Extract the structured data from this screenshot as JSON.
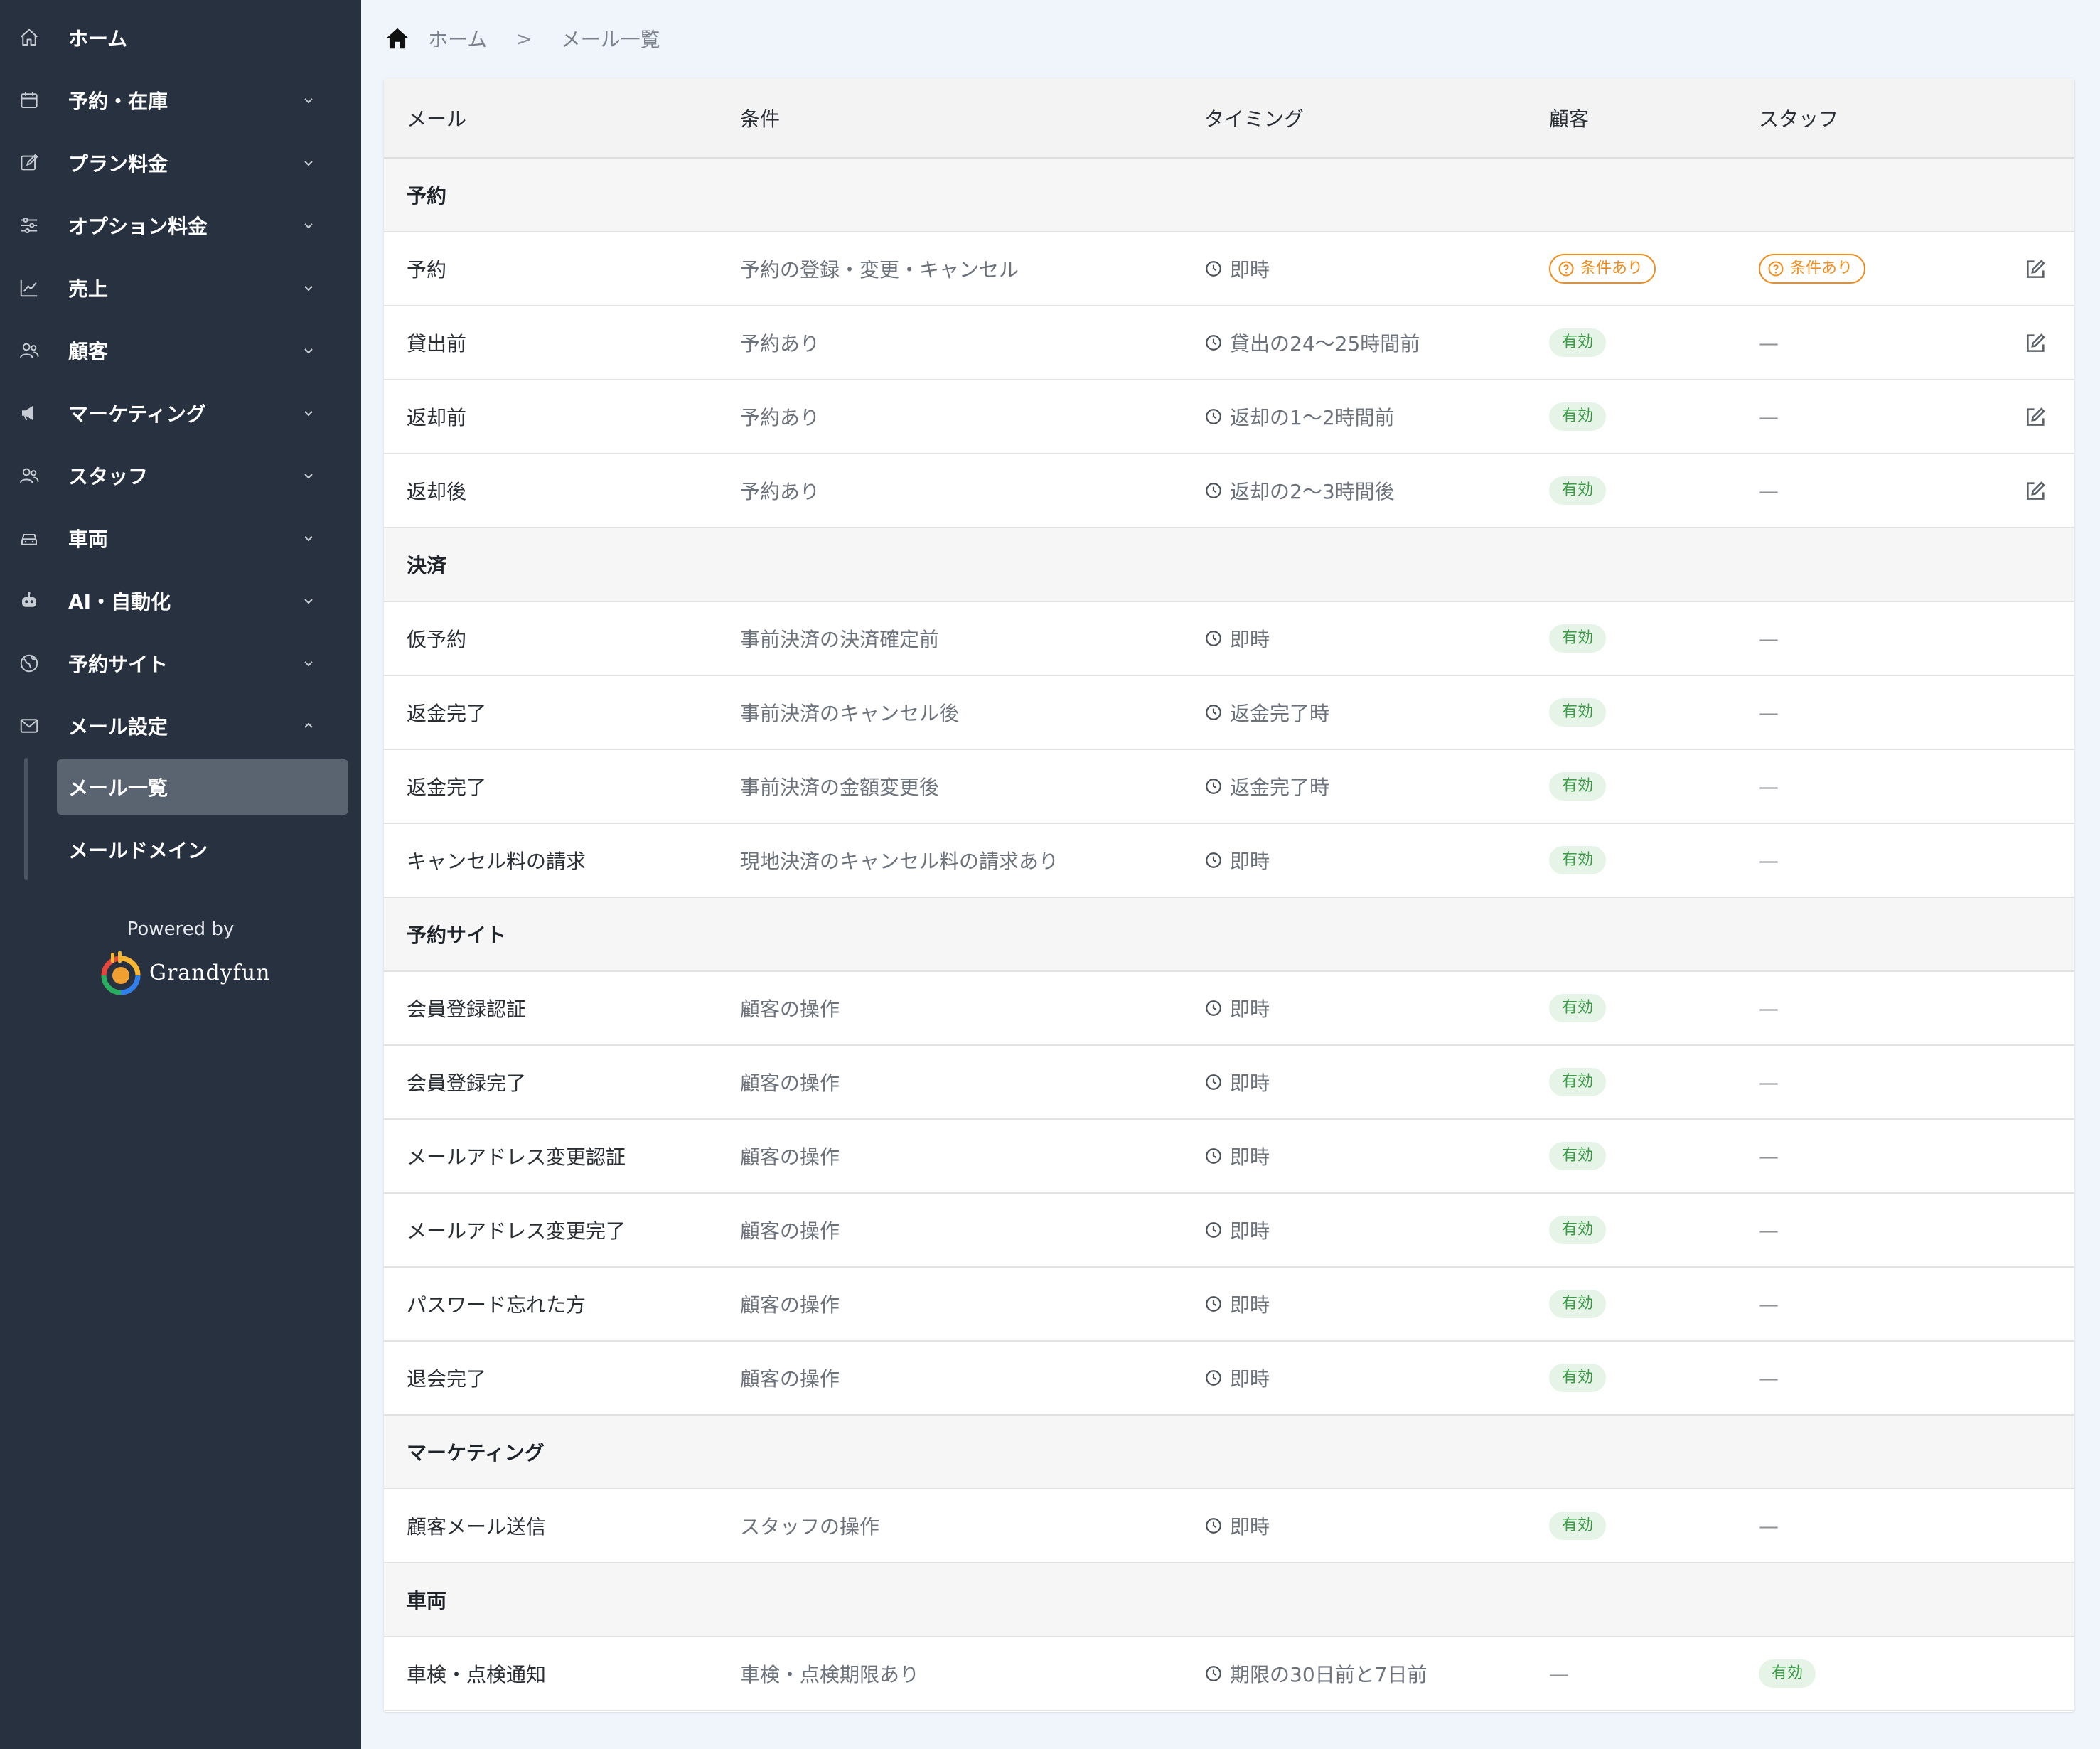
{
  "sidebar": {
    "items": [
      {
        "label": "ホーム",
        "icon": "home-icon",
        "has_chevron": false
      },
      {
        "label": "予約・在庫",
        "icon": "calendar-icon",
        "has_chevron": true
      },
      {
        "label": "プラン料金",
        "icon": "edit-square-icon",
        "has_chevron": true
      },
      {
        "label": "オプション料金",
        "icon": "sliders-icon",
        "has_chevron": true
      },
      {
        "label": "売上",
        "icon": "line-chart-icon",
        "has_chevron": true
      },
      {
        "label": "顧客",
        "icon": "users-icon",
        "has_chevron": true
      },
      {
        "label": "マーケティング",
        "icon": "megaphone-icon",
        "has_chevron": true
      },
      {
        "label": "スタッフ",
        "icon": "staff-icon",
        "has_chevron": true
      },
      {
        "label": "車両",
        "icon": "car-icon",
        "has_chevron": true
      },
      {
        "label": "AI・自動化",
        "icon": "robot-icon",
        "has_chevron": true
      },
      {
        "label": "予約サイト",
        "icon": "globe-icon",
        "has_chevron": true
      },
      {
        "label": "メール設定",
        "icon": "mail-icon",
        "has_chevron": true,
        "expanded": true
      }
    ],
    "sub_items": [
      {
        "label": "メール一覧",
        "active": true
      },
      {
        "label": "メールドメイン",
        "active": false
      }
    ],
    "powered_by": "Powered by",
    "brand": "Grandyfun"
  },
  "breadcrumb": {
    "home": "ホーム",
    "separator": ">",
    "current": "メール一覧"
  },
  "table": {
    "headers": [
      "メール",
      "条件",
      "タイミング",
      "顧客",
      "スタッフ"
    ],
    "rows": [
      {
        "type": "section",
        "title": "予約"
      },
      {
        "type": "row",
        "mail": "予約",
        "condition": "予約の登録・変更・キャンセル",
        "timing": "即時",
        "customer": "条件あり",
        "customer_kind": "cond",
        "staff": "条件あり",
        "staff_kind": "cond",
        "editable": true
      },
      {
        "type": "row",
        "mail": "貸出前",
        "condition": "予約あり",
        "timing": "貸出の24〜25時間前",
        "customer": "有効",
        "customer_kind": "ok",
        "staff": "—",
        "staff_kind": "none",
        "editable": true
      },
      {
        "type": "row",
        "mail": "返却前",
        "condition": "予約あり",
        "timing": "返却の1〜2時間前",
        "customer": "有効",
        "customer_kind": "ok",
        "staff": "—",
        "staff_kind": "none",
        "editable": true
      },
      {
        "type": "row",
        "mail": "返却後",
        "condition": "予約あり",
        "timing": "返却の2〜3時間後",
        "customer": "有効",
        "customer_kind": "ok",
        "staff": "—",
        "staff_kind": "none",
        "editable": true
      },
      {
        "type": "section",
        "title": "決済"
      },
      {
        "type": "row",
        "mail": "仮予約",
        "condition": "事前決済の決済確定前",
        "timing": "即時",
        "customer": "有効",
        "customer_kind": "ok",
        "staff": "—",
        "staff_kind": "none",
        "editable": false
      },
      {
        "type": "row",
        "mail": "返金完了",
        "condition": "事前決済のキャンセル後",
        "timing": "返金完了時",
        "customer": "有効",
        "customer_kind": "ok",
        "staff": "—",
        "staff_kind": "none",
        "editable": false
      },
      {
        "type": "row",
        "mail": "返金完了",
        "condition": "事前決済の金額変更後",
        "timing": "返金完了時",
        "customer": "有効",
        "customer_kind": "ok",
        "staff": "—",
        "staff_kind": "none",
        "editable": false
      },
      {
        "type": "row",
        "mail": "キャンセル料の請求",
        "condition": "現地決済のキャンセル料の請求あり",
        "timing": "即時",
        "customer": "有効",
        "customer_kind": "ok",
        "staff": "—",
        "staff_kind": "none",
        "editable": false
      },
      {
        "type": "section",
        "title": "予約サイト"
      },
      {
        "type": "row",
        "mail": "会員登録認証",
        "condition": "顧客の操作",
        "timing": "即時",
        "customer": "有効",
        "customer_kind": "ok",
        "staff": "—",
        "staff_kind": "none",
        "editable": false
      },
      {
        "type": "row",
        "mail": "会員登録完了",
        "condition": "顧客の操作",
        "timing": "即時",
        "customer": "有効",
        "customer_kind": "ok",
        "staff": "—",
        "staff_kind": "none",
        "editable": false
      },
      {
        "type": "row",
        "mail": "メールアドレス変更認証",
        "condition": "顧客の操作",
        "timing": "即時",
        "customer": "有効",
        "customer_kind": "ok",
        "staff": "—",
        "staff_kind": "none",
        "editable": false
      },
      {
        "type": "row",
        "mail": "メールアドレス変更完了",
        "condition": "顧客の操作",
        "timing": "即時",
        "customer": "有効",
        "customer_kind": "ok",
        "staff": "—",
        "staff_kind": "none",
        "editable": false
      },
      {
        "type": "row",
        "mail": "パスワード忘れた方",
        "condition": "顧客の操作",
        "timing": "即時",
        "customer": "有効",
        "customer_kind": "ok",
        "staff": "—",
        "staff_kind": "none",
        "editable": false
      },
      {
        "type": "row",
        "mail": "退会完了",
        "condition": "顧客の操作",
        "timing": "即時",
        "customer": "有効",
        "customer_kind": "ok",
        "staff": "—",
        "staff_kind": "none",
        "editable": false
      },
      {
        "type": "section",
        "title": "マーケティング"
      },
      {
        "type": "row",
        "mail": "顧客メール送信",
        "condition": "スタッフの操作",
        "timing": "即時",
        "customer": "有効",
        "customer_kind": "ok",
        "staff": "—",
        "staff_kind": "none",
        "editable": false
      },
      {
        "type": "section",
        "title": "車両"
      },
      {
        "type": "row",
        "mail": "車検・点検通知",
        "condition": "車検・点検期限あり",
        "timing": "期限の30日前と7日前",
        "customer": "—",
        "customer_kind": "none",
        "staff": "有効",
        "staff_kind": "ok",
        "editable": false
      }
    ]
  },
  "colors": {
    "sidebar_bg": "#27313f",
    "active_sub_bg": "#5a6370",
    "badge_ok_bg": "#e5f4e6",
    "badge_ok_text": "#3a9a46",
    "badge_cond": "#f08c1c",
    "page_bg": "#f0f5fc"
  }
}
